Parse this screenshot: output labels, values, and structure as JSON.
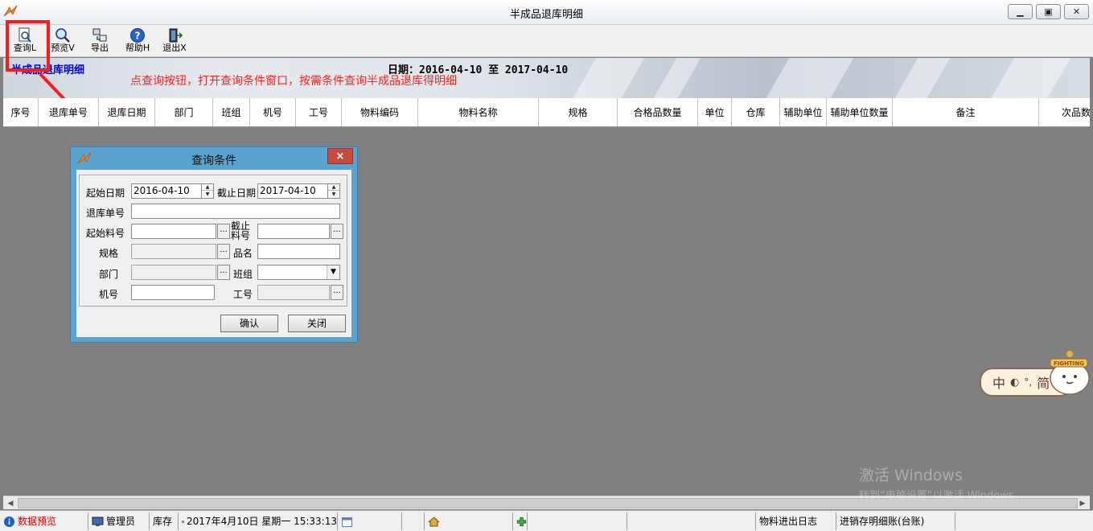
{
  "window": {
    "title": "半成品退库明细"
  },
  "toolbar": {
    "query": "查询L",
    "preview": "预览V",
    "export": "导出",
    "help": "帮助H",
    "exit": "退出X"
  },
  "banner": {
    "name": "半成品退库明细",
    "date_range": "日期：2016-04-10 至 2017-04-10"
  },
  "annotation": "点查询按钮，打开查询条件窗口，按需条件查询半成品退库得明细",
  "columns": [
    "序号",
    "退库单号",
    "退库日期",
    "部门",
    "班组",
    "机号",
    "工号",
    "物料编码",
    "物料名称",
    "规格",
    "合格品数量",
    "单位",
    "仓库",
    "辅助单位",
    "辅助单位数量",
    "备注",
    "次品数"
  ],
  "dialog": {
    "title": "查询条件",
    "close": "×",
    "labels": {
      "start_date": "起始日期",
      "end_date": "截止日期",
      "return_no": "退库单号",
      "start_material": "起始料号",
      "end_material_1": "截止",
      "end_material_2": "料号",
      "spec": "规格",
      "product_name": "品名",
      "department": "部门",
      "team": "班组",
      "machine_no": "机号",
      "employee_no": "工号"
    },
    "values": {
      "start_date": "2016-04-10",
      "end_date": "2017-04-10",
      "return_no": "",
      "start_material": "",
      "end_material": "",
      "spec": "",
      "product_name": "",
      "department": "",
      "team": "",
      "machine_no": "",
      "employee_no": ""
    },
    "browse": "...",
    "confirm": "确认",
    "close_btn": "关闭"
  },
  "statusbar": {
    "data_preview": "数据预览",
    "user": "管理员",
    "module": "库存",
    "datetime": "2017年4月10日 星期一 15:33:13",
    "log": "物料进出日志",
    "ledger": "进销存明细账(台账)"
  },
  "watermark": {
    "line1": "激活 Windows",
    "line2": "转到“电脑设置”以激活 Windows。"
  },
  "ime": {
    "mode": "中",
    "width": "简",
    "sticker": "FIGHTING"
  },
  "colors": {
    "annotation": "#ff2020",
    "banner_title": "#0000d0",
    "dialog_frame": "#5aa3cf",
    "close_red": "#c74a3c"
  }
}
